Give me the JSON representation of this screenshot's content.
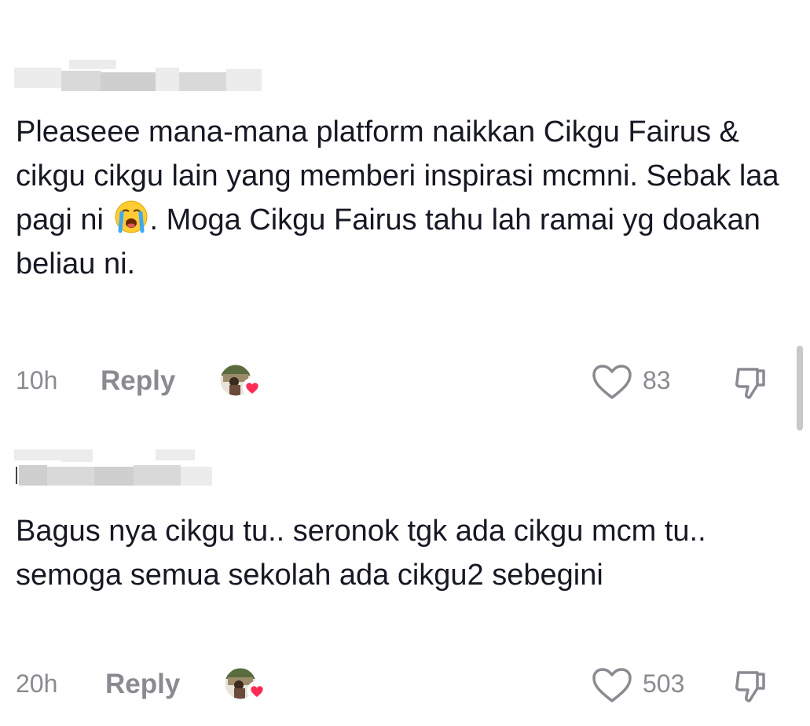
{
  "comments": [
    {
      "text_before_emoji": "Pleaseee mana-mana platform naikkan Cikgu Fairus & cikgu cikgu lain yang memberi inspirasi mcmni. Sebak laa pagi ni ",
      "emoji": "loudly-crying-face",
      "text_after_emoji": ". Moga Cikgu Fairus tahu lah ramai yg doakan beliau ni.",
      "time": "10h",
      "reply_label": "Reply",
      "creator_liked": true,
      "like_count": "83"
    },
    {
      "text": "Bagus nya cikgu tu.. seronok tgk ada cikgu mcm tu.. semoga semua sekolah ada cikgu2 sebegini",
      "time": "20h",
      "reply_label": "Reply",
      "creator_liked": true,
      "like_count": "503"
    }
  ],
  "colors": {
    "text": "#161823",
    "meta": "#8a8b91",
    "heart_badge": "#fe2c55"
  }
}
